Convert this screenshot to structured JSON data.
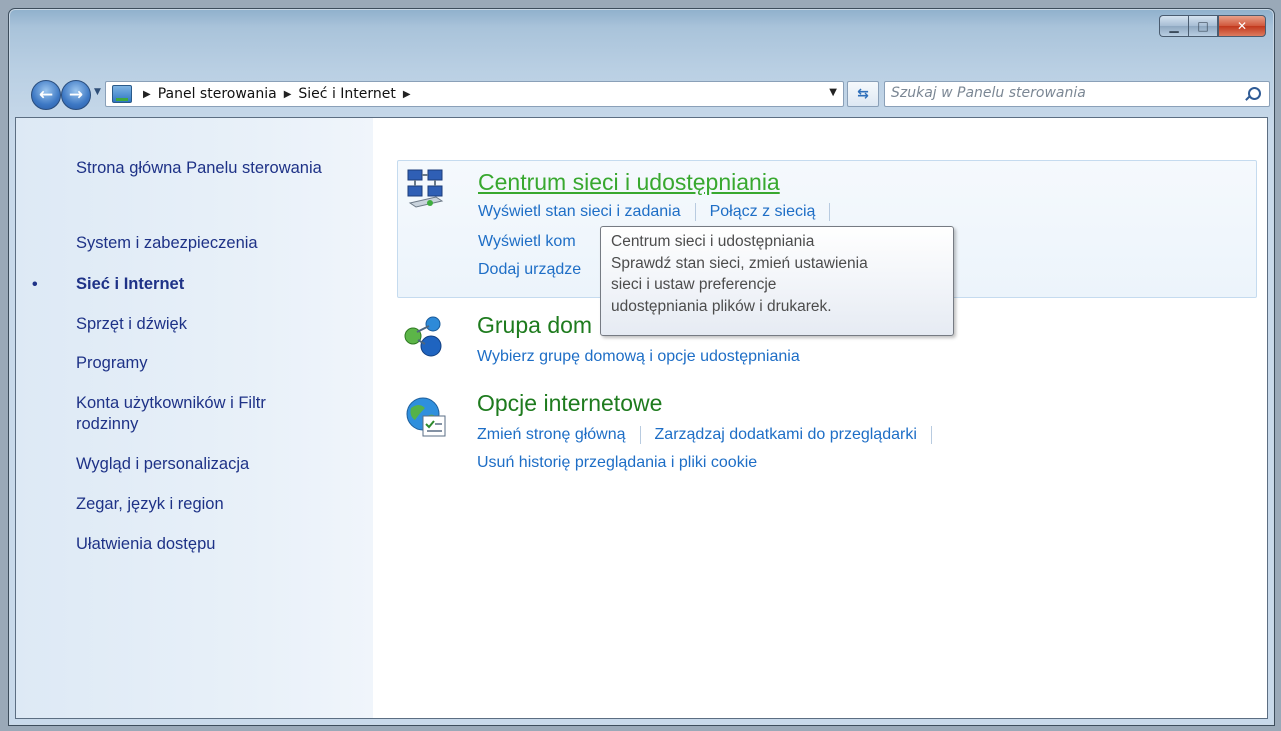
{
  "window": {
    "caption_buttons": {
      "minimize": "minimize",
      "maximize": "maximize",
      "close": "close"
    }
  },
  "navigation": {
    "breadcrumbs": [
      "Panel sterowania",
      "Sieć i Internet"
    ],
    "search_placeholder": "Szukaj w Panelu sterowania"
  },
  "sidebar": {
    "items": [
      {
        "label": "Strona główna Panelu sterowania",
        "current": false
      },
      {
        "label": "System i zabezpieczenia",
        "current": false
      },
      {
        "label": "Sieć i Internet",
        "current": true
      },
      {
        "label": "Sprzęt i dźwięk",
        "current": false
      },
      {
        "label": "Programy",
        "current": false
      },
      {
        "label": "Konta użytkowników i Filtr rodzinny",
        "current": false
      },
      {
        "label": "Wygląd i personalizacja",
        "current": false
      },
      {
        "label": "Zegar, język i region",
        "current": false
      },
      {
        "label": "Ułatwienia dostępu",
        "current": false
      }
    ]
  },
  "categories": [
    {
      "title": "Centrum sieci i udostępniania",
      "icon": "network-center-icon",
      "tasks_row1": [
        "Wyświetl stan sieci i zadania",
        "Połącz z siecią"
      ],
      "tasks_row2": "Wyświetl kom",
      "tasks_row3": "Dodaj urządze"
    },
    {
      "title": "Grupa dom",
      "icon": "homegroup-icon",
      "tasks_row1": "Wybierz grupę domową i opcje udostępniania"
    },
    {
      "title": "Opcje internetowe",
      "icon": "internet-options-icon",
      "tasks_row1": [
        "Zmień stronę główną",
        "Zarządzaj dodatkami do przeglądarki"
      ],
      "tasks_row2": "Usuń historię przeglądania i pliki cookie"
    }
  ],
  "tooltip": {
    "lines": [
      "Centrum sieci i udostępniania",
      "Sprawdź stan sieci, zmień ustawienia",
      "sieci i ustaw preferencje",
      "udostępniania plików i drukarek."
    ]
  },
  "colors": {
    "link": "#1e6ec6",
    "category_title": "#1e7b1e",
    "sidebar_text": "#1e3287"
  }
}
